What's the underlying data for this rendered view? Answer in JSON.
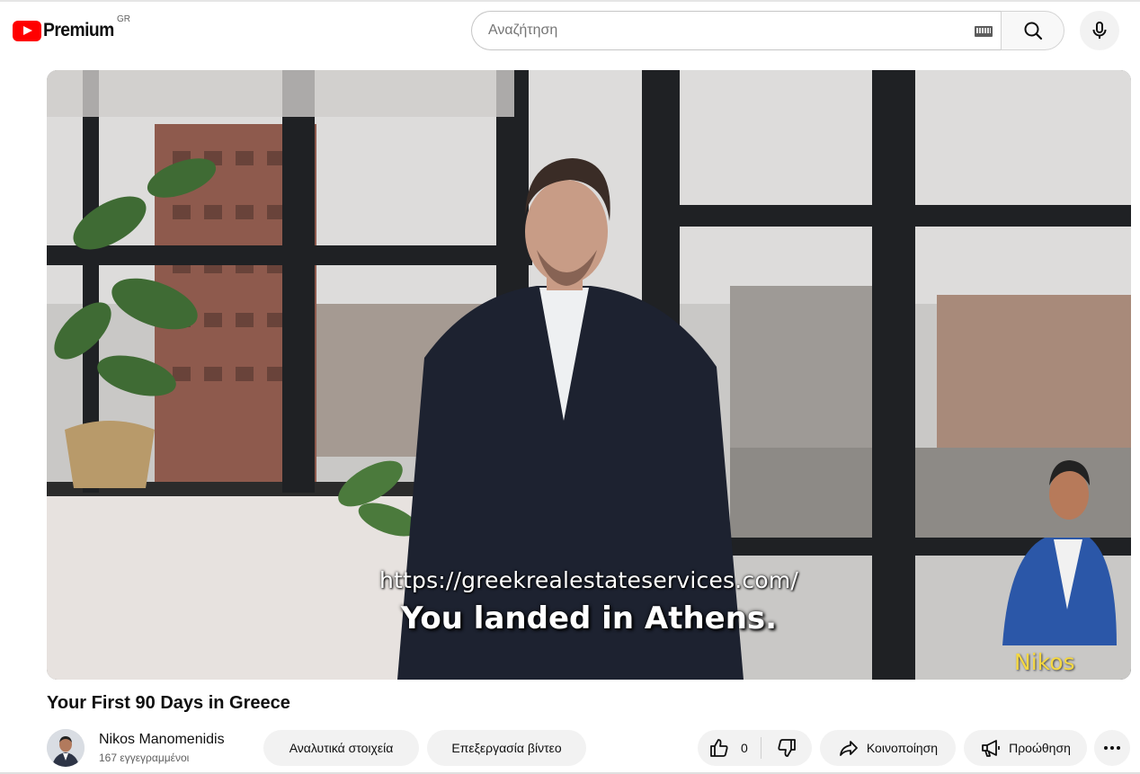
{
  "masthead": {
    "logo_text": "Premium",
    "region": "GR",
    "search_placeholder": "Αναζήτηση",
    "logo_icon": "youtube-play-icon",
    "keyboard_icon": "keyboard-icon",
    "search_icon": "search-icon",
    "mic_icon": "microphone-icon"
  },
  "player": {
    "caption_url": "https://greekrealestateservices.com/",
    "caption_main": "You landed in Athens.",
    "presenter_tag": "Nikos"
  },
  "video": {
    "title": "Your First 90 Days in Greece"
  },
  "owner": {
    "channel_name": "Nikos Manomenidis",
    "subscribers": "167 εγγεγραμμένοι"
  },
  "actions": {
    "analytics": "Αναλυτικά στοιχεία",
    "edit_video": "Επεξεργασία βίντεο",
    "like_count": "0",
    "share": "Κοινοποίηση",
    "promote": "Προώθηση",
    "like_icon": "thumbs-up-icon",
    "dislike_icon": "thumbs-down-icon",
    "share_icon": "share-arrow-icon",
    "promote_icon": "megaphone-icon",
    "more_icon": "more-horizontal-icon"
  },
  "colors": {
    "brand_red": "#ff0000",
    "button_bg": "#f2f2f2",
    "presenter_tag": "#f5d842"
  }
}
